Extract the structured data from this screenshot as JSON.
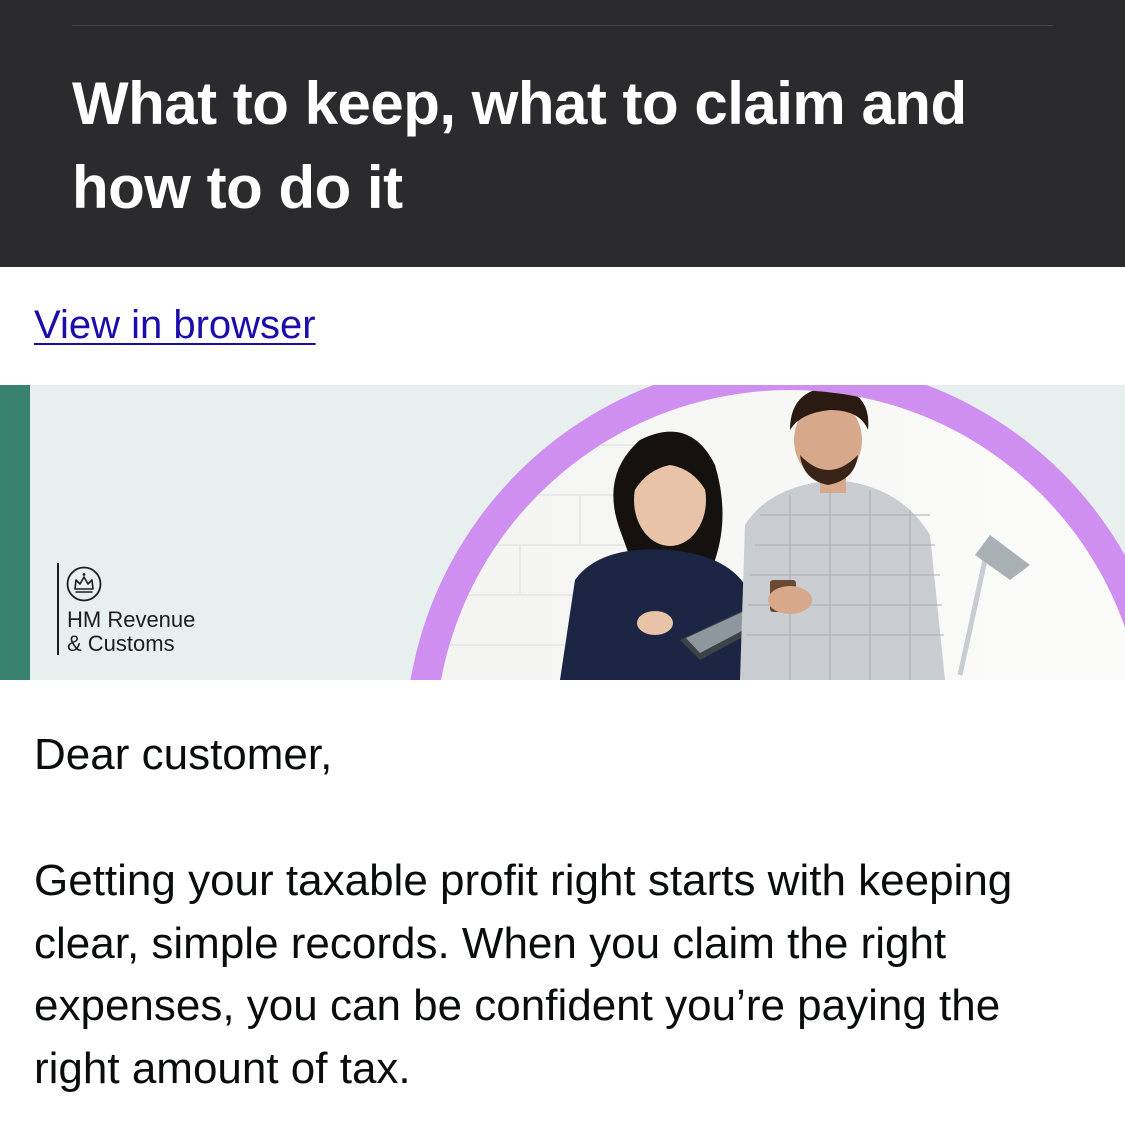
{
  "header": {
    "title": "What to keep, what to claim and how to do it"
  },
  "links": {
    "view_in_browser": "View in browser"
  },
  "banner": {
    "logo_text": "HM Revenue\n& Customs",
    "accent_color": "#3a8270",
    "ring_color": "#cf8ff0",
    "background_color": "#e7f0ef",
    "photo_description_icon": "people-with-tablet-photo"
  },
  "email": {
    "greeting": "Dear customer,",
    "paragraph_1": "Getting your taxable profit right starts with keeping clear, simple records. When you claim the right expenses, you can be confident you’re paying the right amount of tax."
  },
  "colors": {
    "header_bg": "#2b2b2d",
    "link": "#1a0dab",
    "text": "#0b0c0c"
  }
}
